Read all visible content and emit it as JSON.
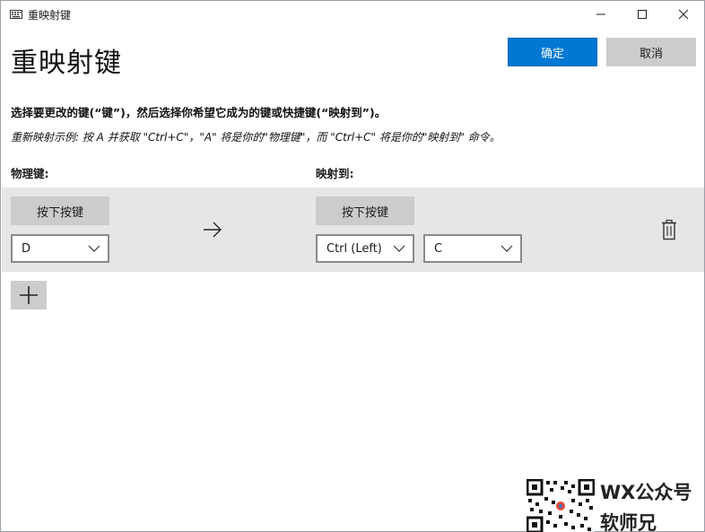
{
  "window": {
    "title": "重映射键",
    "icons": {
      "app": "keyboard-icon",
      "minimize": "minimize-icon",
      "maximize": "maximize-icon",
      "close": "close-icon"
    }
  },
  "header": {
    "title": "重映射键",
    "ok_label": "确定",
    "cancel_label": "取消"
  },
  "instructions": {
    "main": "选择要更改的键(“键”)，然后选择你希望它成为的键或快捷键(“映射到”)。",
    "example": "重新映射示例: 按 A 并获取 \"Ctrl+C\"，\"A\" 将是你的\"物理键\"，而 \"Ctrl+C\" 将是你的\"映射到\" 命令。"
  },
  "columns": {
    "physical": "物理键:",
    "mapped": "映射到:"
  },
  "mapping_row": {
    "physical_press_label": "按下按键",
    "physical_key": "D",
    "mapped_press_label": "按下按键",
    "mapped_modifier": "Ctrl (Left)",
    "mapped_key": "C"
  },
  "colors": {
    "accent": "#0078d4",
    "row_background": "#e6e6e6",
    "button_gray": "#cccccc"
  },
  "watermark": {
    "line1": "WX公众号",
    "line2": "软师兄"
  }
}
